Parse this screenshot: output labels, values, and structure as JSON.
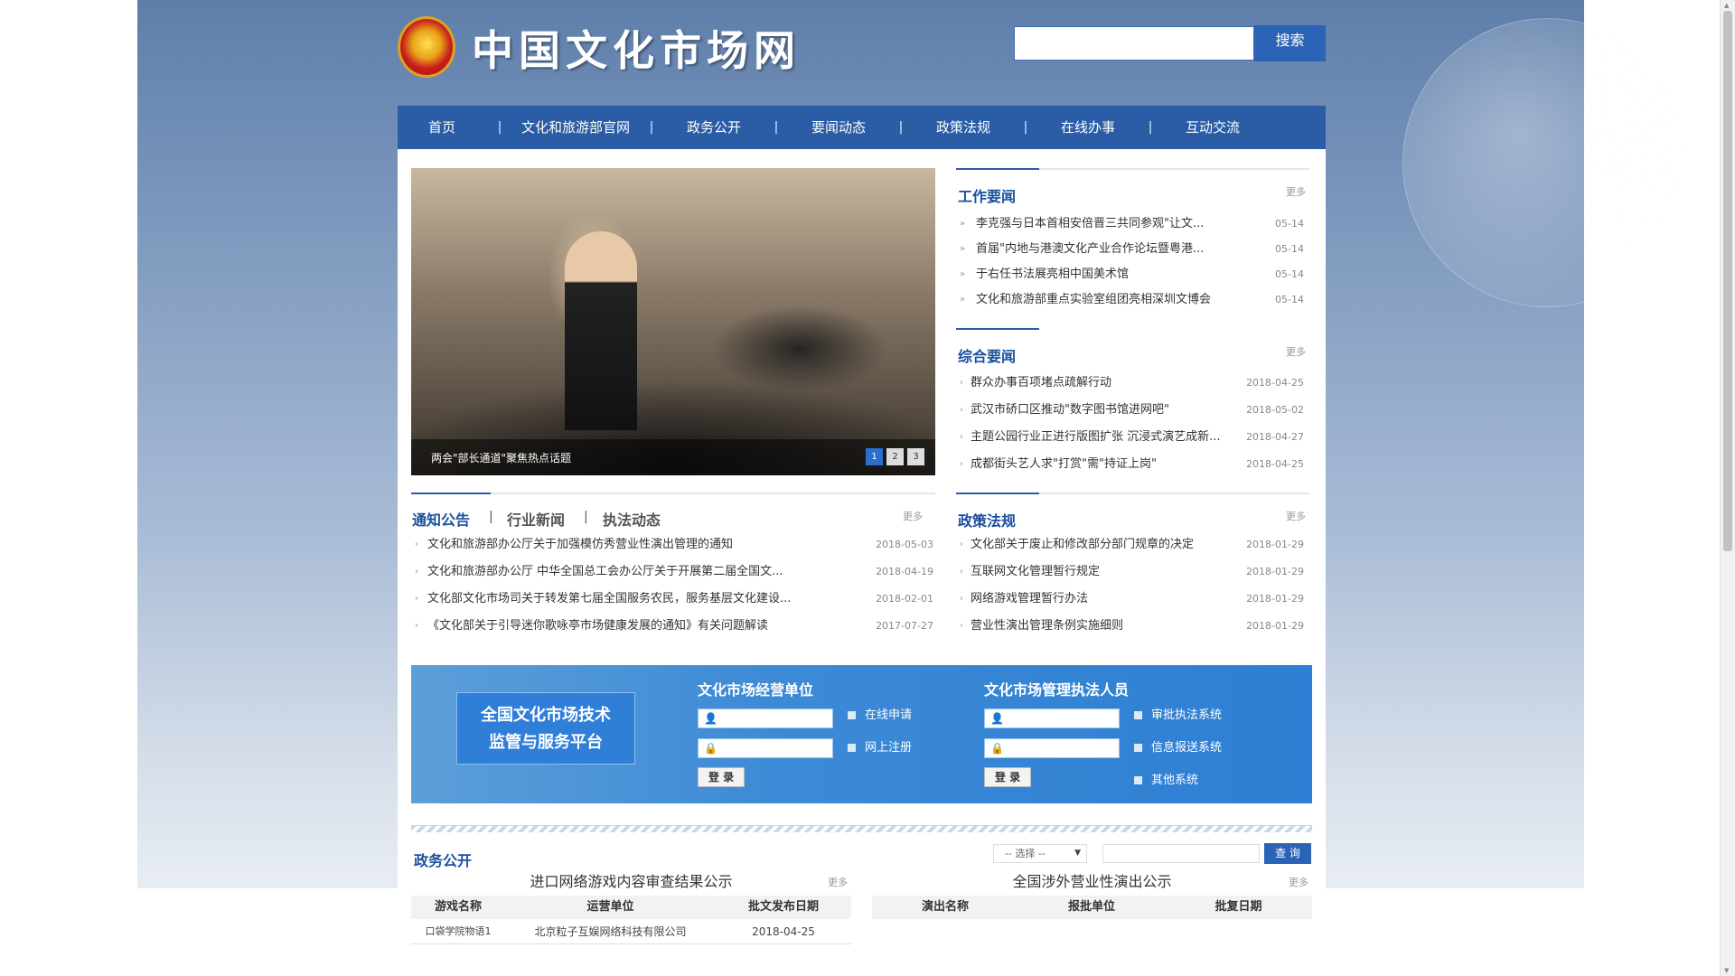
{
  "site": {
    "title": "中国文化市场网",
    "search_button": "搜索",
    "search_placeholder": ""
  },
  "nav": [
    "首页",
    "文化和旅游部官网",
    "政务公开",
    "要闻动态",
    "政策法规",
    "在线办事",
    "互动交流"
  ],
  "slider": {
    "caption": "两会\"部长通道\"聚焦热点话题",
    "dots": [
      "1",
      "2",
      "3"
    ],
    "active_dot": 1
  },
  "work_news": {
    "title": "工作要闻",
    "more": "更多",
    "items": [
      {
        "text": "李克强与日本首相安倍晋三共同参观\"让文...",
        "date": "05-14"
      },
      {
        "text": "首届\"内地与港澳文化产业合作论坛暨粤港...",
        "date": "05-14"
      },
      {
        "text": "于右任书法展亮相中国美术馆",
        "date": "05-14"
      },
      {
        "text": "文化和旅游部重点实验室组团亮相深圳文博会",
        "date": "05-14"
      }
    ]
  },
  "general_news": {
    "title": "综合要闻",
    "more": "更多",
    "items": [
      {
        "text": "群众办事百项堵点疏解行动",
        "date": "2018-04-25"
      },
      {
        "text": "武汉市硚口区推动\"数字图书馆进网吧\"",
        "date": "2018-05-02"
      },
      {
        "text": "主题公园行业正进行版图扩张 沉浸式演艺成新...",
        "date": "2018-04-27"
      },
      {
        "text": "成都街头艺人求\"打赏\"需\"持证上岗\"",
        "date": "2018-04-25"
      }
    ]
  },
  "notice": {
    "tabs": [
      "通知公告",
      "行业新闻",
      "执法动态"
    ],
    "tab_sep": "|",
    "more": "更多",
    "items": [
      {
        "text": "文化和旅游部办公厅关于加强模仿秀营业性演出管理的通知",
        "date": "2018-05-03"
      },
      {
        "text": "文化和旅游部办公厅 中华全国总工会办公厅关于开展第二届全国文...",
        "date": "2018-04-19"
      },
      {
        "text": "文化部文化市场司关于转发第七届全国服务农民，服务基层文化建设...",
        "date": "2018-02-01"
      },
      {
        "text": "《文化部关于引导迷你歌咏亭市场健康发展的通知》有关问题解读",
        "date": "2017-07-27"
      }
    ]
  },
  "policy": {
    "title": "政策法规",
    "more": "更多",
    "items": [
      {
        "text": "文化部关于废止和修改部分部门规章的决定",
        "date": "2018-01-29"
      },
      {
        "text": "互联网文化管理暂行规定",
        "date": "2018-01-29"
      },
      {
        "text": "网络游戏管理暂行办法",
        "date": "2018-01-29"
      },
      {
        "text": "营业性演出管理条例实施细则",
        "date": "2018-01-29"
      }
    ]
  },
  "platform": {
    "logo_line1": "全国文化市场技术",
    "logo_line2": "监管与服务平台",
    "col1_title": "文化市场经营单位",
    "col2_title": "文化市场管理执法人员",
    "login": "登 录",
    "col1_links": [
      "在线申请",
      "网上注册"
    ],
    "col2_links": [
      "审批执法系统",
      "信息报送系统",
      "其他系统"
    ],
    "user_icon": "user-icon",
    "lock_icon": "lock-icon"
  },
  "gov": {
    "title": "政务公开",
    "select": "-- 选择 --",
    "query": "查 询"
  },
  "games": {
    "title": "进口网络游戏内容审查结果公示",
    "more": "更多",
    "headers": [
      "游戏名称",
      "运营单位",
      "批文发布日期"
    ],
    "rows": [
      [
        "口袋学院物语1",
        "北京粒子互娱网络科技有限公司",
        "2018-04-25"
      ]
    ]
  },
  "shows": {
    "title": "全国涉外营业性演出公示",
    "more": "更多",
    "headers": [
      "演出名称",
      "报批单位",
      "批复日期"
    ]
  },
  "colors": {
    "nav_blue": "#2a5da6",
    "title_blue": "#1a4fa0",
    "platform_blue": "#2d7fd3"
  }
}
